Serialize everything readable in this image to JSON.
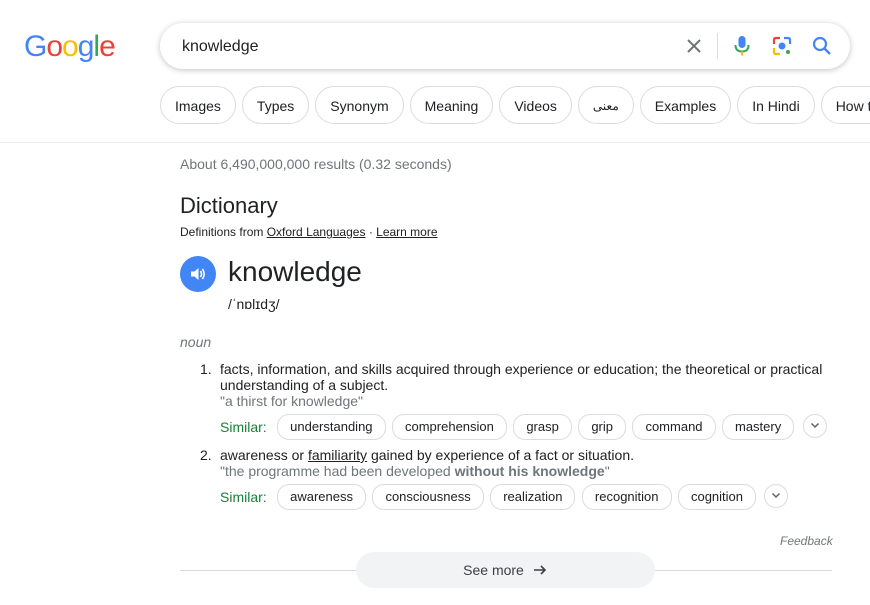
{
  "logo": {
    "letters": [
      "G",
      "o",
      "o",
      "g",
      "l",
      "e"
    ],
    "colors": [
      "#4285f4",
      "#ea4335",
      "#fbbc05",
      "#4285f4",
      "#34a853",
      "#ea4335"
    ]
  },
  "search": {
    "value": "knowledge"
  },
  "icons": {
    "clear": "close-icon",
    "voice": "mic-icon",
    "lens": "lens-icon",
    "search": "search-icon"
  },
  "chips": [
    "Images",
    "Types",
    "Synonym",
    "Meaning",
    "Videos",
    "معنی",
    "Examples",
    "In Hindi",
    "How to"
  ],
  "stats": "About 6,490,000,000 results (0.32 seconds)",
  "dictionary": {
    "title": "Dictionary",
    "source_prefix": "Definitions from",
    "source_link": "Oxford Languages",
    "separator": "·",
    "learn_more": "Learn more",
    "word": "knowledge",
    "phonetic": "/ˈnɒlɪdʒ/",
    "part_of_speech": "noun",
    "definitions": [
      {
        "number": "1.",
        "text": "facts, information, and skills acquired through experience or education; the theoretical or practical understanding of a subject.",
        "example": "\"a thirst for knowledge\"",
        "similar_label": "Similar:",
        "similar": [
          "understanding",
          "comprehension",
          "grasp",
          "grip",
          "command",
          "mastery"
        ]
      },
      {
        "number": "2.",
        "text_before": "awareness or ",
        "text_link": "familiarity",
        "text_after": " gained by experience of a fact or situation.",
        "example_before": "\"the programme had been developed ",
        "example_bold": "without his knowledge",
        "example_after": "\"",
        "similar_label": "Similar:",
        "similar": [
          "awareness",
          "consciousness",
          "realization",
          "recognition",
          "cognition"
        ]
      }
    ],
    "feedback": "Feedback",
    "see_more": "See more"
  },
  "colors": {
    "accent": "#4285f4",
    "similar_green": "#188038",
    "muted": "#70757a"
  }
}
